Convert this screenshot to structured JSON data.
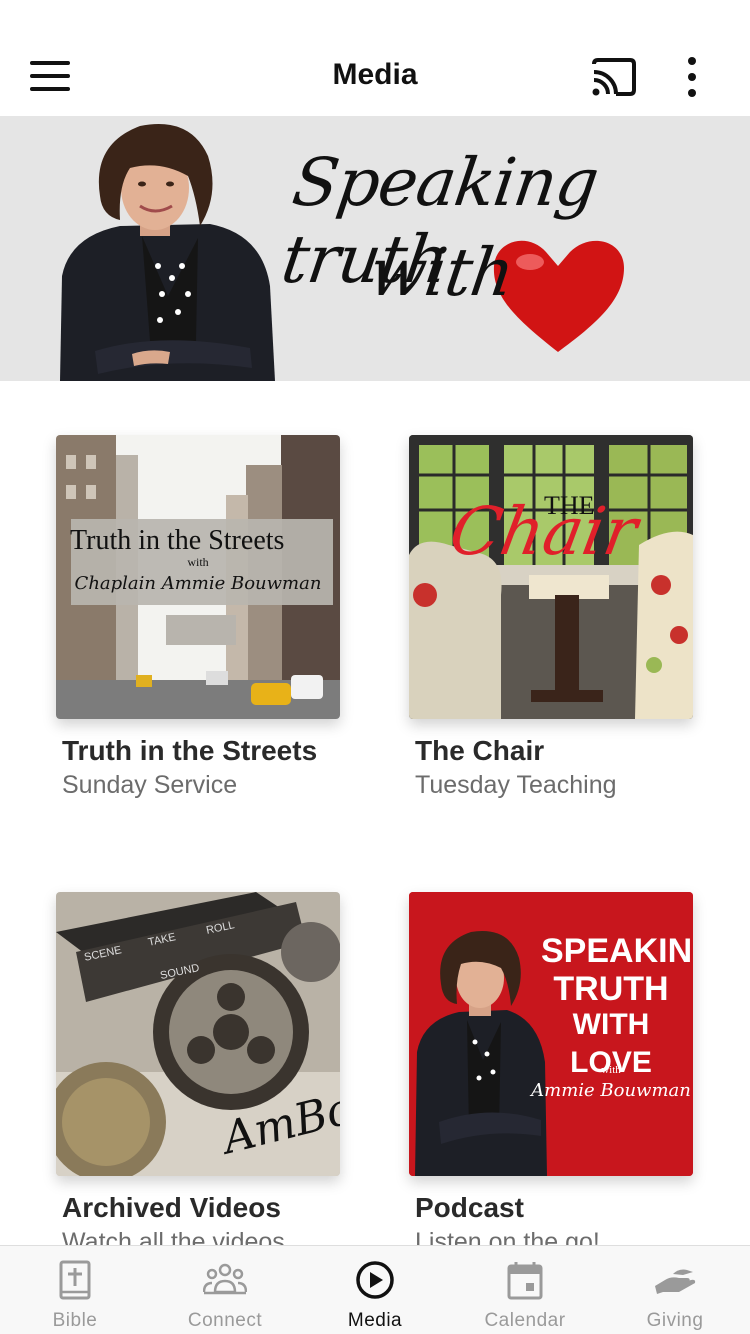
{
  "app_bar": {
    "title": "Media",
    "menu_icon": "hamburger-menu-icon",
    "cast_icon": "cast-icon",
    "more_icon": "more-vertical-icon"
  },
  "hero": {
    "line1": "Speaking truth",
    "line2": "with"
  },
  "cards": [
    {
      "title": "Truth in the Streets",
      "subtitle": "Sunday Service",
      "art_heading": "Truth in the Streets",
      "art_with": "with",
      "art_signature": "Chaplain Ammie Bouwman"
    },
    {
      "title": "The Chair",
      "subtitle": "Tuesday Teaching",
      "art_the": "THE",
      "art_chair": "Chair"
    },
    {
      "title": "Archived Videos",
      "subtitle": "Watch all the videos",
      "art_clap_1": "SCENE",
      "art_clap_2": "TAKE",
      "art_clap_3": "ROLL",
      "art_clap_4": "SOUND",
      "art_logo": "AmBo"
    },
    {
      "title": "Podcast",
      "subtitle": "Listen on the go!",
      "art_line1": "SPEAKING",
      "art_line2": "TRUTH",
      "art_line3": "WITH LOVE",
      "art_with": "with",
      "art_signature": "Ammie Bouwman"
    }
  ],
  "tabs": [
    {
      "label": "Bible",
      "icon": "bible-icon",
      "active": false
    },
    {
      "label": "Connect",
      "icon": "people-icon",
      "active": false
    },
    {
      "label": "Media",
      "icon": "play-circle-icon",
      "active": true
    },
    {
      "label": "Calendar",
      "icon": "calendar-icon",
      "active": false
    },
    {
      "label": "Giving",
      "icon": "giving-hand-icon",
      "active": false
    }
  ],
  "colors": {
    "accent": "#111111",
    "inactive_tab": "#9a9a9a",
    "hero_bg": "#e5e5e5",
    "heart": "#d11414",
    "podcast_bg": "#c8161d",
    "chair_script": "#e0202a"
  }
}
